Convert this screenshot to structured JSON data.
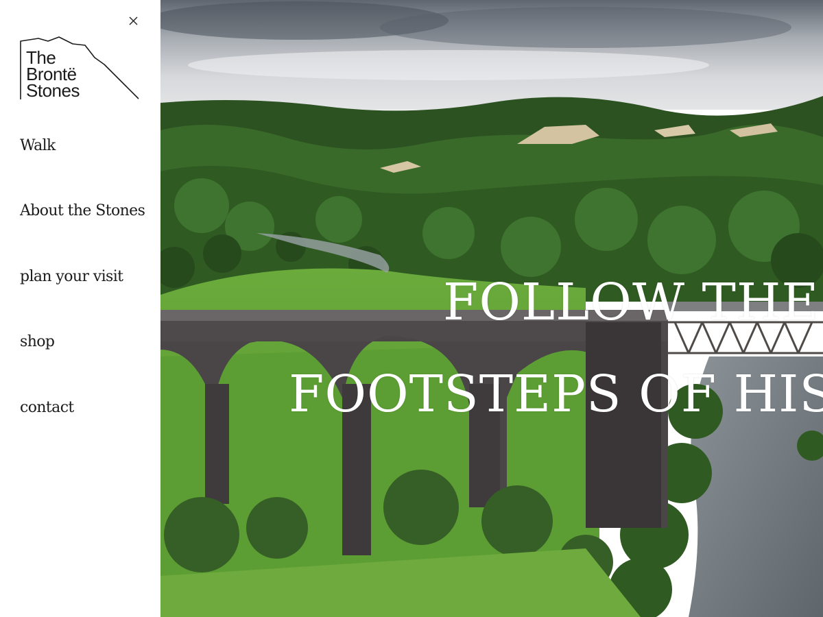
{
  "brand": {
    "logo_lines": [
      "The",
      "Brontë",
      "Stones"
    ],
    "logo_icon": "hill-outline-icon"
  },
  "menu": {
    "close_icon": "close-icon",
    "items": [
      {
        "label": "Walk"
      },
      {
        "label": "About the Stones"
      },
      {
        "label": "plan your visit"
      },
      {
        "label": "shop"
      },
      {
        "label": "contact"
      }
    ]
  },
  "hero": {
    "headline_line1": "FOLLOW THE",
    "headline_line2": "FOOTSTEPS OF HIST",
    "colors": {
      "text": "#ffffff",
      "sky": "#c9ccd0",
      "forest": "#2f5a24",
      "field": "#6fae3c",
      "viaduct": "#4e4a4c",
      "river": "#7b8288"
    }
  }
}
